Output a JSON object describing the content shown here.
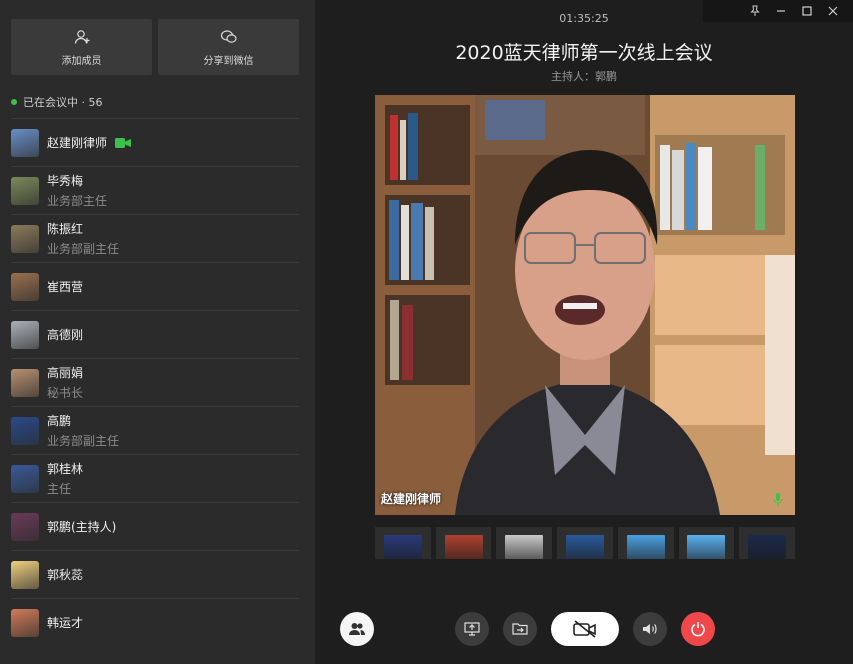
{
  "header": {
    "timer": "01:35:25",
    "title": "2020蓝天律师第一次线上会议",
    "host": "主持人：郭鹏"
  },
  "sidebar": {
    "add_member": "添加成员",
    "share_wechat": "分享到微信",
    "in_meeting": "已在会议中 · 56",
    "members": [
      {
        "name": "赵建刚律师",
        "role": "",
        "camera": true,
        "avatar_color": "#6a8fc7"
      },
      {
        "name": "毕秀梅",
        "role": "业务部主任",
        "avatar_color": "#7a8a5a"
      },
      {
        "name": "陈振红",
        "role": "业务部副主任",
        "avatar_color": "#8a7a5a"
      },
      {
        "name": "崔西营",
        "role": "",
        "avatar_color": "#9a7050"
      },
      {
        "name": "高德刚",
        "role": "",
        "avatar_color": "#aab2b8"
      },
      {
        "name": "高丽娟",
        "role": "秘书长",
        "avatar_color": "#b89070"
      },
      {
        "name": "高鹏",
        "role": "业务部副主任",
        "avatar_color": "#2a4a8a"
      },
      {
        "name": "郭桂林",
        "role": "主任",
        "avatar_color": "#3a5a9a"
      },
      {
        "name": "郭鹏(主持人)",
        "role": "",
        "avatar_color": "#6a3a5a"
      },
      {
        "name": "郭秋蕊",
        "role": "",
        "avatar_color": "#f0d080"
      },
      {
        "name": "韩运才",
        "role": "",
        "avatar_color": "#d07a5a"
      }
    ]
  },
  "video": {
    "speaker_label": "赵建刚律师"
  },
  "thumbnails": [
    {
      "color": "#2a3a7a"
    },
    {
      "color": "#b04030"
    },
    {
      "color": "#c8c8c8"
    },
    {
      "color": "#2a5a9a"
    },
    {
      "color": "#4aa0e0"
    },
    {
      "color": "#5ab0f0"
    },
    {
      "color": "#1a2a4a"
    }
  ],
  "colors": {
    "accent_green": "#3dc14c",
    "hangup_red": "#f0474a"
  }
}
